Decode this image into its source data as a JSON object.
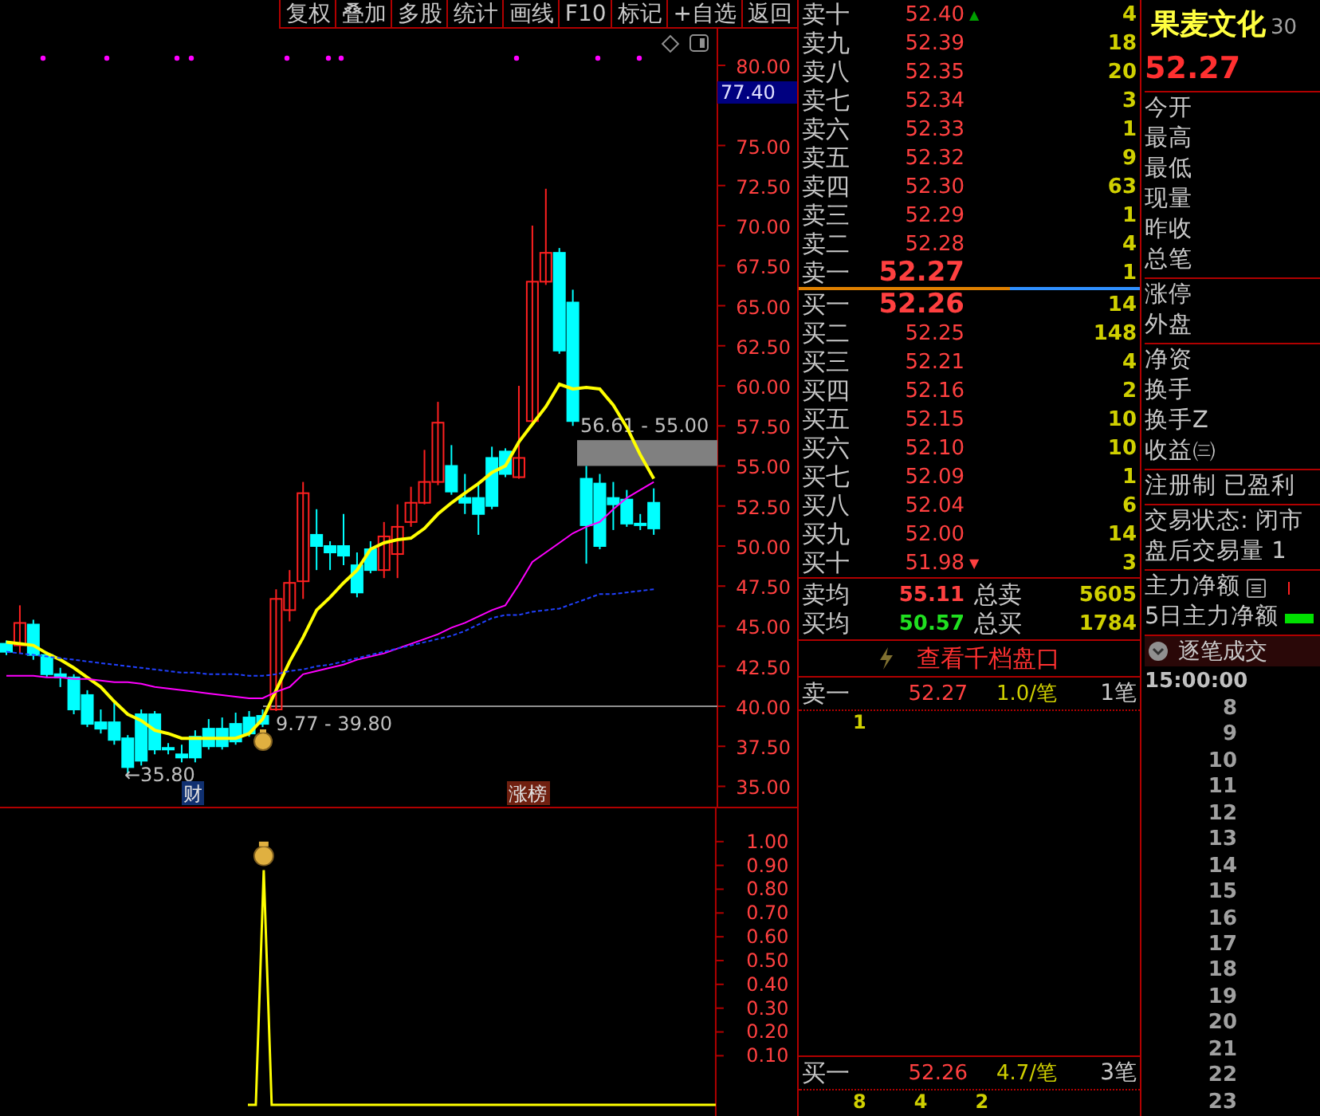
{
  "toolbar": [
    "复权",
    "叠加",
    "多股",
    "统计",
    "画线",
    "F10",
    "标记",
    "+自选",
    "返回"
  ],
  "price_chart": {
    "cursor_price": "77.40",
    "chart_data": {
      "type": "candlestick",
      "ylim": [
        33.73,
        82.29
      ],
      "categories": [
        null,
        null,
        null,
        null,
        null,
        null,
        null,
        null,
        null,
        null,
        null,
        null,
        null,
        null,
        null,
        null,
        null,
        null,
        null,
        null,
        null,
        null,
        null,
        null,
        null,
        null,
        null,
        null,
        null,
        null,
        null,
        null,
        null,
        null,
        null,
        null,
        null,
        null,
        null,
        null,
        null,
        null,
        null,
        null,
        null,
        null,
        null,
        null,
        null
      ],
      "yticks": [
        {
          "value": 80,
          "label": "80.00"
        },
        {
          "value": 75,
          "label": "75.00"
        },
        {
          "value": 72.5,
          "label": "72.50"
        },
        {
          "value": 70,
          "label": "70.00"
        },
        {
          "value": 67.5,
          "label": "67.50"
        },
        {
          "value": 65,
          "label": "65.00"
        },
        {
          "value": 62.5,
          "label": "62.50"
        },
        {
          "value": 60,
          "label": "60.00"
        },
        {
          "value": 57.5,
          "label": "57.50"
        },
        {
          "value": 55,
          "label": "55.00"
        },
        {
          "value": 52.5,
          "label": "52.50"
        },
        {
          "value": 50,
          "label": "50.00"
        },
        {
          "value": 47.5,
          "label": "47.50"
        },
        {
          "value": 45,
          "label": "45.00"
        },
        {
          "value": 42.5,
          "label": "42.50"
        },
        {
          "value": 40,
          "label": "40.00"
        },
        {
          "value": 37.5,
          "label": "37.50"
        },
        {
          "value": 35,
          "label": "35.00"
        }
      ],
      "ohlc": [
        [
          43.9,
          44.1,
          43.2,
          43.4
        ],
        [
          43.8,
          46.3,
          43.3,
          45.2
        ],
        [
          45.1,
          45.4,
          42.9,
          43.2
        ],
        [
          43.2,
          43.4,
          41.8,
          42.0
        ],
        [
          42.0,
          42.4,
          41.2,
          41.8
        ],
        [
          41.8,
          42.0,
          39.5,
          39.8
        ],
        [
          40.7,
          41.0,
          38.7,
          38.9
        ],
        [
          39.0,
          39.8,
          38.3,
          38.6
        ],
        [
          39.0,
          40.2,
          37.6,
          37.9
        ],
        [
          38.0,
          38.2,
          35.8,
          36.2
        ],
        [
          39.5,
          39.8,
          36.3,
          36.6
        ],
        [
          39.5,
          39.7,
          37.0,
          37.3
        ],
        [
          37.4,
          37.7,
          37.0,
          37.3
        ],
        [
          37.0,
          37.6,
          36.5,
          36.8
        ],
        [
          38.1,
          38.5,
          36.5,
          36.8
        ],
        [
          38.6,
          39.2,
          37.3,
          37.5
        ],
        [
          38.6,
          39.3,
          37.3,
          37.5
        ],
        [
          38.9,
          39.6,
          37.6,
          37.8
        ],
        [
          39.3,
          39.7,
          38.1,
          38.3
        ],
        [
          39.4,
          39.8,
          38.7,
          38.9
        ],
        [
          39.8,
          47.3,
          39.7,
          46.7
        ],
        [
          46.0,
          48.5,
          45.3,
          47.7
        ],
        [
          47.8,
          54.0,
          46.7,
          53.3
        ],
        [
          50.7,
          52.3,
          48.5,
          50.0
        ],
        [
          50.0,
          50.3,
          48.5,
          49.6
        ],
        [
          50.0,
          52.0,
          48.8,
          49.4
        ],
        [
          48.8,
          49.6,
          46.8,
          47.1
        ],
        [
          49.8,
          50.3,
          48.3,
          48.5
        ],
        [
          48.5,
          51.5,
          48.0,
          50.6
        ],
        [
          49.5,
          52.6,
          48.0,
          51.2
        ],
        [
          51.5,
          53.7,
          51.2,
          52.7
        ],
        [
          52.7,
          56.0,
          52.6,
          54.0
        ],
        [
          54.0,
          59.0,
          53.8,
          57.7
        ],
        [
          55.0,
          56.3,
          53.2,
          53.4
        ],
        [
          53.0,
          54.5,
          52.0,
          52.7
        ],
        [
          53.0,
          54.0,
          50.7,
          52.0
        ],
        [
          55.5,
          56.2,
          52.3,
          52.5
        ],
        [
          55.9,
          56.1,
          54.3,
          54.5
        ],
        [
          54.3,
          60.0,
          54.2,
          55.5
        ],
        [
          57.8,
          70.0,
          57.6,
          66.5
        ],
        [
          66.5,
          72.3,
          66.3,
          68.3
        ],
        [
          68.3,
          68.6,
          62.0,
          62.2
        ],
        [
          65.2,
          66.0,
          57.5,
          57.8
        ],
        [
          54.2,
          55.0,
          48.9,
          51.3
        ],
        [
          53.9,
          54.5,
          49.8,
          50.0
        ],
        [
          53.0,
          54.0,
          51.0,
          52.6
        ],
        [
          52.9,
          53.5,
          51.2,
          51.4
        ],
        [
          51.4,
          52.0,
          51.0,
          51.3
        ],
        [
          52.7,
          53.6,
          50.7,
          51.1
        ]
      ],
      "series": [
        {
          "type": "line",
          "color": "#ffff00",
          "line_style": "solid",
          "values": [
            44.0,
            43.9,
            43.8,
            43.3,
            42.9,
            42.4,
            41.8,
            41.2,
            40.3,
            39.5,
            39.1,
            38.5,
            38.3,
            38.0,
            38.0,
            38.0,
            38.0,
            38.0,
            38.3,
            39.2,
            41.0,
            42.8,
            44.3,
            46.0,
            46.8,
            47.7,
            48.5,
            49.8,
            50.2,
            50.4,
            50.5,
            51.1,
            52.0,
            52.7,
            53.3,
            53.9,
            54.6,
            55.0,
            56.5,
            57.6,
            58.7,
            60.1,
            59.8,
            59.9,
            59.8,
            58.8,
            57.4,
            55.7,
            54.2
          ]
        },
        {
          "type": "line",
          "color": "#ff00ff",
          "line_style": "solid",
          "values": [
            41.9,
            41.9,
            41.9,
            41.8,
            41.8,
            41.7,
            41.7,
            41.6,
            41.5,
            41.5,
            41.4,
            41.2,
            41.1,
            41.0,
            40.9,
            40.8,
            40.7,
            40.6,
            40.5,
            40.5,
            40.9,
            41.2,
            42.0,
            42.2,
            42.4,
            42.6,
            42.9,
            43.1,
            43.3,
            43.6,
            43.9,
            44.2,
            44.5,
            44.9,
            45.2,
            45.6,
            46.0,
            46.3,
            47.6,
            49.0,
            49.6,
            50.2,
            50.8,
            51.2,
            51.5,
            52.3,
            53.0,
            53.5,
            54.0
          ]
        },
        {
          "type": "line",
          "color": "#2040ff",
          "line_style": "dashed",
          "values": [
            43.4,
            43.3,
            43.2,
            43.1,
            43.0,
            42.9,
            42.8,
            42.7,
            42.6,
            42.5,
            42.4,
            42.3,
            42.2,
            42.1,
            42.1,
            42.0,
            42.0,
            42.0,
            41.9,
            41.9,
            42.0,
            42.2,
            42.3,
            42.5,
            42.6,
            42.8,
            43.0,
            43.2,
            43.4,
            43.6,
            43.8,
            44.0,
            44.2,
            44.4,
            44.7,
            45.1,
            45.5,
            45.7,
            45.7,
            45.9,
            46.0,
            46.1,
            46.4,
            46.7,
            47.0,
            47.0,
            47.1,
            47.2,
            47.3
          ]
        }
      ],
      "bands": [
        {
          "axis": "y",
          "from": 55.0,
          "to": 56.61,
          "color": "#808080",
          "label": "56.61 - 55.00"
        }
      ]
    }
  },
  "chart_notes": {
    "low_mark": "←35.80",
    "signal_range": "9.77 - 39.80",
    "finance_tag": "财",
    "rank_tag": "涨榜"
  },
  "indicator_axis": {
    "labels": [
      "1.00",
      "0.90",
      "0.80",
      "0.70",
      "0.60",
      "0.50",
      "0.40",
      "0.30",
      "0.20",
      "0.10"
    ]
  },
  "order_book": {
    "asks": [
      {
        "label": "卖十",
        "price": "52.40",
        "volume": "4",
        "mark": "▲"
      },
      {
        "label": "卖九",
        "price": "52.39",
        "volume": "18"
      },
      {
        "label": "卖八",
        "price": "52.35",
        "volume": "20"
      },
      {
        "label": "卖七",
        "price": "52.34",
        "volume": "3"
      },
      {
        "label": "卖六",
        "price": "52.33",
        "volume": "1"
      },
      {
        "label": "卖五",
        "price": "52.32",
        "volume": "9"
      },
      {
        "label": "卖四",
        "price": "52.30",
        "volume": "63"
      },
      {
        "label": "卖三",
        "price": "52.29",
        "volume": "1"
      },
      {
        "label": "卖二",
        "price": "52.28",
        "volume": "4"
      },
      {
        "label": "卖一",
        "price": "52.27",
        "volume": "1",
        "best": true
      }
    ],
    "bids": [
      {
        "label": "买一",
        "price": "52.26",
        "volume": "14",
        "best": true
      },
      {
        "label": "买二",
        "price": "52.25",
        "volume": "148"
      },
      {
        "label": "买三",
        "price": "52.21",
        "volume": "4"
      },
      {
        "label": "买四",
        "price": "52.16",
        "volume": "2"
      },
      {
        "label": "买五",
        "price": "52.15",
        "volume": "10"
      },
      {
        "label": "买六",
        "price": "52.10",
        "volume": "10"
      },
      {
        "label": "买七",
        "price": "52.09",
        "volume": "1"
      },
      {
        "label": "买八",
        "price": "52.04",
        "volume": "6"
      },
      {
        "label": "买九",
        "price": "52.00",
        "volume": "14"
      },
      {
        "label": "买十",
        "price": "51.98",
        "volume": "3",
        "mark": "▼"
      }
    ],
    "averages": [
      {
        "label": "卖均",
        "price": "55.11",
        "total_label": "总卖",
        "total": "5605",
        "color": "#ff4040"
      },
      {
        "label": "买均",
        "price": "50.57",
        "total_label": "总买",
        "total": "1784",
        "color": "#20e020"
      }
    ],
    "depth_link": "查看千档盘口",
    "queues": [
      {
        "label": "卖一",
        "price": "52.27",
        "per_order": "1.0/笔",
        "orders": "1笔",
        "items": [
          "1"
        ]
      },
      {
        "label": "买一",
        "price": "52.26",
        "per_order": "4.7/笔",
        "orders": "3笔",
        "items": [
          "8",
          "4",
          "2"
        ]
      }
    ]
  },
  "quote": {
    "name": "果麦文化",
    "code": "30",
    "price": "52.27",
    "groups": [
      [
        "今开",
        "最高",
        "最低",
        "现量",
        "昨收",
        "总笔"
      ],
      [
        "涨停",
        "外盘"
      ],
      [
        "净资",
        "换手",
        "换手Z",
        "收益㈢"
      ],
      [
        "注册制 已盈利"
      ],
      [
        "交易状态: 闭市",
        "盘后交易量 1"
      ]
    ],
    "flows": [
      {
        "label": "主力净额",
        "kind": "tick"
      },
      {
        "label": "5日主力净额",
        "kind": "bar"
      }
    ],
    "ticks_title": "逐笔成交",
    "ticks_time": "15:00:00",
    "ticks": [
      "8",
      "9",
      "10",
      "11",
      "12",
      "13",
      "14",
      "15",
      "16",
      "17",
      "18",
      "19",
      "20",
      "21",
      "22",
      "23"
    ]
  }
}
